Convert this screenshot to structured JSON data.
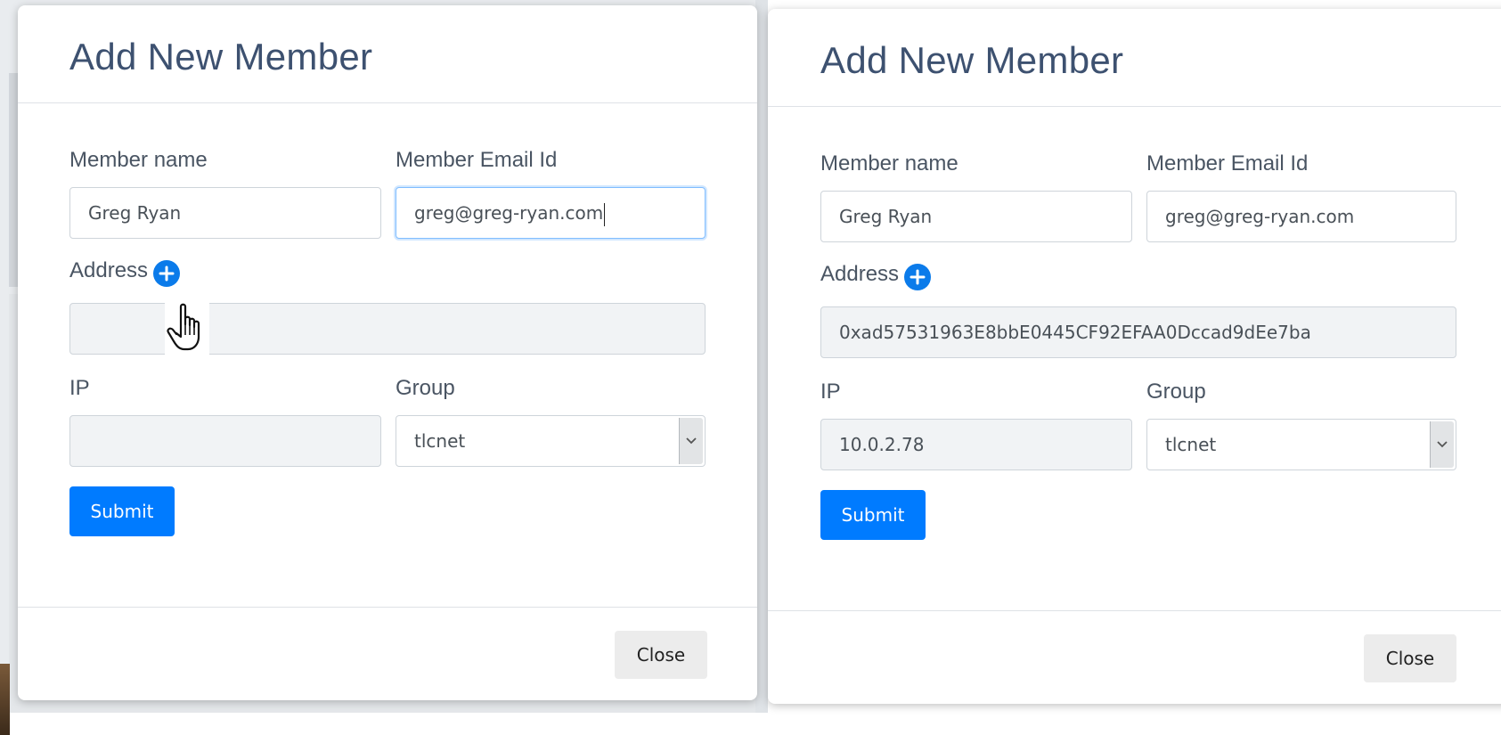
{
  "left_dialog": {
    "title": "Add New Member",
    "member_name": {
      "label": "Member name",
      "value": "Greg Ryan"
    },
    "member_email": {
      "label": "Member Email Id",
      "value": "greg@greg-ryan.com"
    },
    "address": {
      "label": "Address",
      "value": ""
    },
    "ip": {
      "label": "IP",
      "value": ""
    },
    "group": {
      "label": "Group",
      "selected": "tlcnet"
    },
    "submit_label": "Submit",
    "close_label": "Close"
  },
  "right_dialog": {
    "title": "Add New Member",
    "member_name": {
      "label": "Member name",
      "value": "Greg Ryan"
    },
    "member_email": {
      "label": "Member Email Id",
      "value": "greg@greg-ryan.com"
    },
    "address": {
      "label": "Address",
      "value": "0xad57531963E8bbE0445CF92EFAA0Dccad9dEe7ba"
    },
    "ip": {
      "label": "IP",
      "value": "10.0.2.78"
    },
    "group": {
      "label": "Group",
      "selected": "tlcnet"
    },
    "submit_label": "Submit",
    "close_label": "Close"
  },
  "icons": {
    "add": "plus-circle-icon",
    "dropdown": "chevron-down-icon",
    "cursor": "hand-pointer-icon"
  },
  "colors": {
    "primary": "#007bff",
    "add_icon": "#0b7bea",
    "title": "#3d5170"
  }
}
